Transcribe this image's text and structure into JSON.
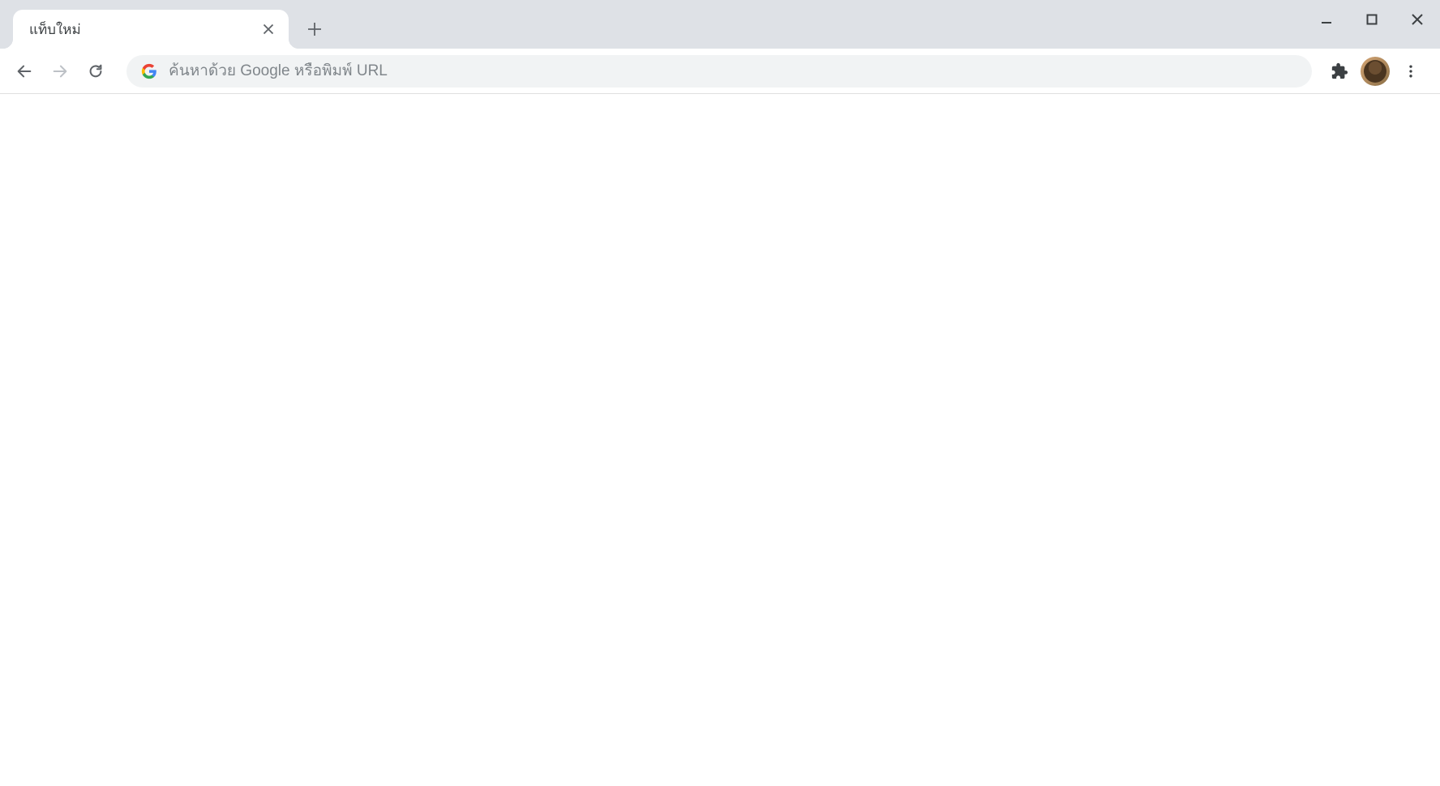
{
  "tab": {
    "title": "แท็บใหม่"
  },
  "omnibox": {
    "placeholder": "ค้นหาด้วย Google หรือพิมพ์ URL",
    "value": ""
  }
}
